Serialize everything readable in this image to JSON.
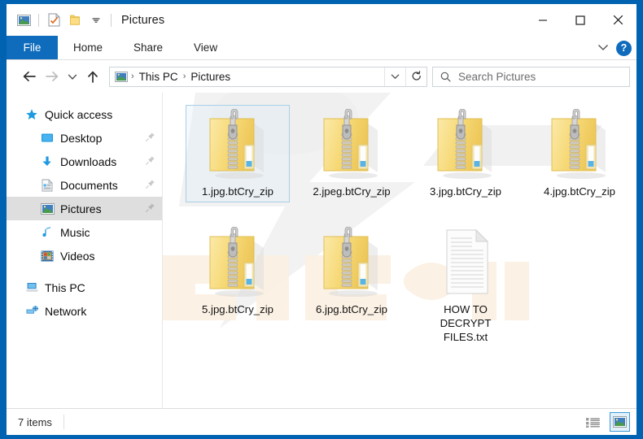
{
  "window": {
    "title": "Pictures",
    "accent_color": "#0063b1",
    "file_tab_color": "#0f6cbd"
  },
  "quick_access_toolbar": {
    "items": [
      {
        "name": "pictures-icon",
        "label": "Pictures"
      },
      {
        "name": "properties-icon",
        "label": "Properties"
      },
      {
        "name": "new-folder-icon",
        "label": "New folder"
      },
      {
        "name": "customize-dropdown-icon",
        "label": "Customize Quick Access Toolbar"
      }
    ]
  },
  "window_controls": {
    "minimize": "─",
    "maximize": "□",
    "close": "✕"
  },
  "ribbon": {
    "tabs": [
      {
        "label": "File",
        "active": true
      },
      {
        "label": "Home",
        "active": false
      },
      {
        "label": "Share",
        "active": false
      },
      {
        "label": "View",
        "active": false
      }
    ],
    "expand_label": "⌄",
    "help_label": "?"
  },
  "navigation": {
    "back_label": "Back",
    "forward_label": "Forward",
    "recent_label": "Recent locations",
    "up_label": "Up",
    "refresh_label": "Refresh",
    "history_label": "Previous locations",
    "breadcrumbs": [
      {
        "label": "This PC"
      },
      {
        "label": "Pictures"
      }
    ],
    "separator": "›"
  },
  "search": {
    "placeholder": "Search Pictures"
  },
  "sidebar": {
    "items": [
      {
        "label": "Quick access",
        "icon": "star-icon",
        "level": 0,
        "pinned": false,
        "selected": false
      },
      {
        "label": "Desktop",
        "icon": "desktop-icon",
        "level": 1,
        "pinned": true,
        "selected": false
      },
      {
        "label": "Downloads",
        "icon": "downloads-icon",
        "level": 1,
        "pinned": true,
        "selected": false
      },
      {
        "label": "Documents",
        "icon": "documents-icon",
        "level": 1,
        "pinned": true,
        "selected": false
      },
      {
        "label": "Pictures",
        "icon": "pictures-icon",
        "level": 1,
        "pinned": true,
        "selected": true
      },
      {
        "label": "Music",
        "icon": "music-icon",
        "level": 1,
        "pinned": false,
        "selected": false
      },
      {
        "label": "Videos",
        "icon": "videos-icon",
        "level": 1,
        "pinned": false,
        "selected": false
      },
      {
        "label": "This PC",
        "icon": "this-pc-icon",
        "level": 0,
        "pinned": false,
        "selected": false
      },
      {
        "label": "Network",
        "icon": "network-icon",
        "level": 0,
        "pinned": false,
        "selected": false
      }
    ]
  },
  "files": [
    {
      "name": "1.jpg.btCry_zip",
      "icon": "zip-folder-icon",
      "selected": true
    },
    {
      "name": "2.jpeg.btCry_zip",
      "icon": "zip-folder-icon",
      "selected": false
    },
    {
      "name": "3.jpg.btCry_zip",
      "icon": "zip-folder-icon",
      "selected": false
    },
    {
      "name": "4.jpg.btCry_zip",
      "icon": "zip-folder-icon",
      "selected": false
    },
    {
      "name": "5.jpg.btCry_zip",
      "icon": "zip-folder-icon",
      "selected": false
    },
    {
      "name": "6.jpg.btCry_zip",
      "icon": "zip-folder-icon",
      "selected": false
    },
    {
      "name": "HOW TO DECRYPT FILES.txt",
      "icon": "text-file-icon",
      "selected": false
    }
  ],
  "statusbar": {
    "item_count": "7 items",
    "details_view_label": "Details view",
    "large_icons_view_label": "Large icons view",
    "active_view": "large-icons"
  }
}
